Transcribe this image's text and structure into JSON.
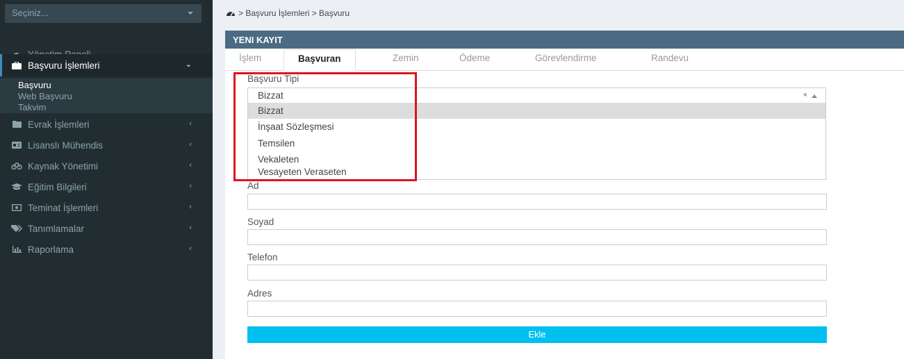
{
  "sidebar": {
    "select_placeholder": "Seçiniz...",
    "items": [
      {
        "label": "Yönetim Paneli",
        "icon": "dashboard-icon"
      },
      {
        "label": "Başvuru İşlemleri",
        "icon": "briefcase-icon",
        "chevron": "⌄"
      },
      {
        "label": "Evrak İşlemleri",
        "icon": "folder-icon",
        "chevron": "‹"
      },
      {
        "label": "Lisanslı Mühendis",
        "icon": "id-card-icon",
        "chevron": "‹"
      },
      {
        "label": "Kaynak Yönetimi",
        "icon": "bicycle-icon",
        "chevron": "‹"
      },
      {
        "label": "Eğitim Bilgileri",
        "icon": "graduation-cap-icon",
        "chevron": "‹"
      },
      {
        "label": "Teminat İşlemleri",
        "icon": "money-icon",
        "chevron": "‹"
      },
      {
        "label": "Tanımlamalar",
        "icon": "tags-icon",
        "chevron": "‹"
      },
      {
        "label": "Raporlama",
        "icon": "bar-chart-icon",
        "chevron": "‹"
      }
    ],
    "submenu": [
      "Başvuru",
      "Web Başvuru",
      "Takvim"
    ]
  },
  "breadcrumb": "> Başvuru İşlemleri > Başvuru",
  "box": {
    "title": "YENI KAYIT",
    "tabs": [
      "İşlem",
      "Başvuran",
      "Zemin",
      "Ödeme",
      "Görevlendirme",
      "Randevu"
    ],
    "active_tab": "Başvuran"
  },
  "form": {
    "basvuru_tipi_label": "Başvuru Tipi",
    "basvuru_tipi_value": "Bizzat",
    "clear_symbol": "×",
    "options": [
      "Bizzat",
      "İnşaat Sözleşmesi",
      "Temsilen",
      "Vekaleten",
      "Vesayeten Veraseten"
    ],
    "highlighted_option": "Bizzat",
    "ad_label": "Ad",
    "soyad_label": "Soyad",
    "telefon_label": "Telefon",
    "adres_label": "Adres",
    "ekle_label": "Ekle"
  },
  "colors": {
    "sidebar_bg": "#222d32",
    "header_bg": "#4a6b83",
    "button_bg": "#00c0ef",
    "highlight_frame": "#e0131f"
  }
}
